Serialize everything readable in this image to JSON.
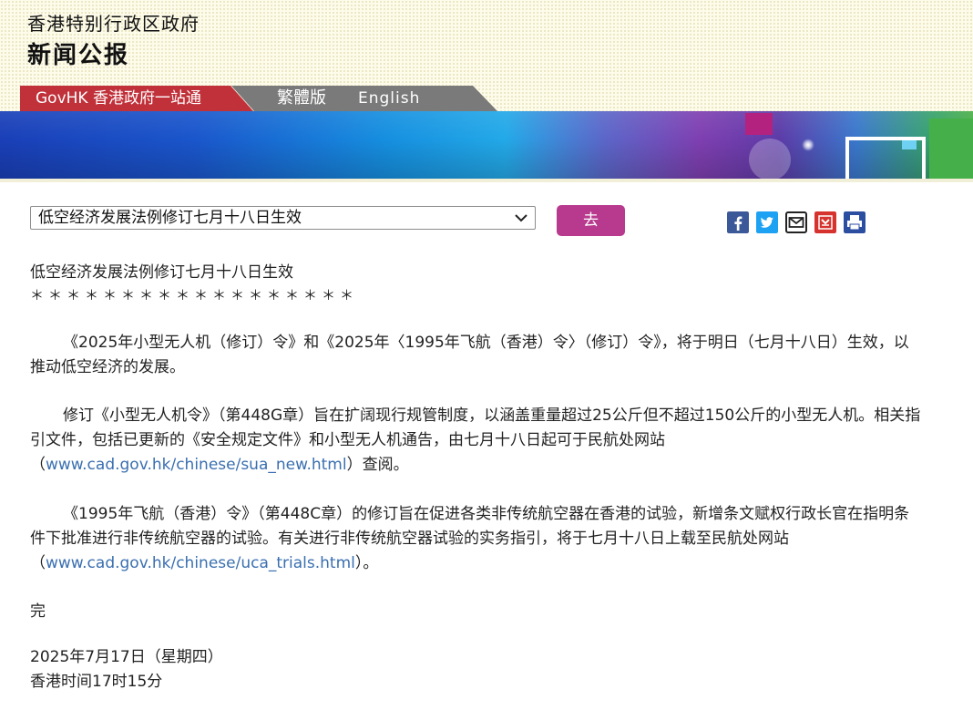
{
  "header": {
    "org_name": "香港特别行政区政府",
    "title": "新闻公报"
  },
  "nav": {
    "govhk_label": "GovHK 香港政府一站通",
    "traditional_label": "繁體版",
    "english_label": "English"
  },
  "toolbar": {
    "selected_press_release": "低空经济发展法例修订七月十八日生效",
    "go_button_label": "去"
  },
  "share_icons": [
    "facebook-icon",
    "twitter-icon",
    "email-icon",
    "bookmark-icon",
    "print-icon"
  ],
  "colors": {
    "govhk_tab": "#c0313a",
    "lang_tab": "#7a7a7a",
    "go_button": "#b83a8e",
    "link": "#3a6fb0",
    "facebook": "#3b5998",
    "twitter": "#1da1f2",
    "bookmark": "#d6332f",
    "print": "#2c4ea0"
  },
  "article": {
    "title": "低空经济发展法例修订七月十八日生效",
    "separator": "＊＊＊＊＊＊＊＊＊＊＊＊＊＊＊＊＊＊",
    "para1": "《2025年小型无人机（修订）令》和《2025年〈1995年飞航（香港）令〉（修订）令》，将于明日（七月十八日）生效，以推动低空经济的发展。",
    "para2_text_before": "修订《小型无人机令》（第448G章）旨在扩阔现行规管制度，以涵盖重量超过25公斤但不超过150公斤的小型无人机。相关指引文件，包括已更新的《安全规定文件》和小型无人机通告，由七月十八日起可于民航处网站（",
    "para2_link": "www.cad.gov.hk/chinese/sua_new.html",
    "para2_text_after": "）查阅。",
    "para3_text_before": "《1995年飞航（香港）令》（第448C章）的修订旨在促进各类非传统航空器在香港的试验，新增条文赋权行政长官在指明条件下批准进行非传统航空器的试验。有关进行非传统航空器试验的实务指引，将于七月十八日上载至民航处网站（",
    "para3_link": "www.cad.gov.hk/chinese/uca_trials.html",
    "para3_text_after": "）。",
    "end_mark": "完",
    "date": "2025年7月17日（星期四）",
    "time": "香港时间17时15分"
  }
}
